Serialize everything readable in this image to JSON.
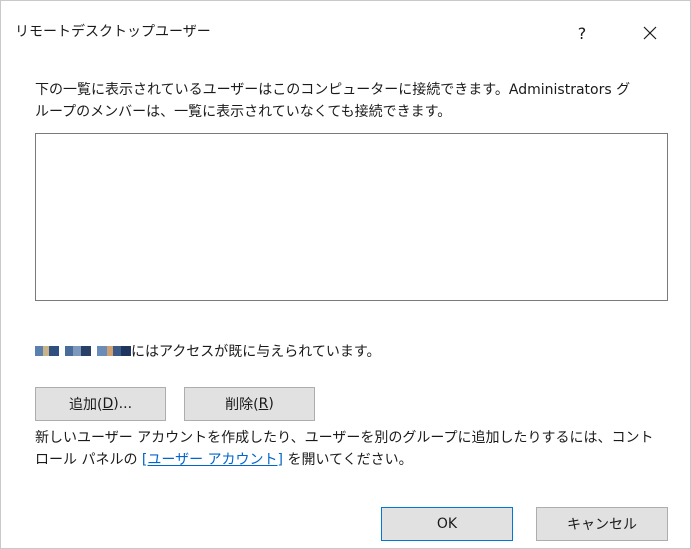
{
  "dialog": {
    "title": "リモートデスクトップユーザー",
    "help_label": "?",
    "close_icon": "close-icon"
  },
  "description": {
    "line1": "下の一覧に表示されているユーザーはこのコンピューターに接続できます。Administrators グ",
    "line2": "ループのメンバーは、一覧に表示されていなくても接続できます。"
  },
  "users_list": {
    "items": []
  },
  "access": {
    "redacted_name_icon": "redacted-name",
    "text": "にはアクセスが既に与えられています。"
  },
  "buttons": {
    "add_prefix": "追加(",
    "add_key": "D",
    "add_suffix": ")...",
    "remove_prefix": "削除(",
    "remove_key": "R",
    "remove_suffix": ")",
    "ok": "OK",
    "cancel": "キャンセル"
  },
  "help": {
    "line1": "新しいユーザー アカウントを作成したり、ユーザーを別のグループに追加したりするには、コント",
    "line2_prefix": "ロール パネルの ",
    "link_text": "[ユーザー アカウント]",
    "line2_suffix": " を開いてください。"
  },
  "colors": {
    "link": "#0066cc",
    "ok_border": "#0078d7",
    "button_bg": "#e1e1e1"
  }
}
